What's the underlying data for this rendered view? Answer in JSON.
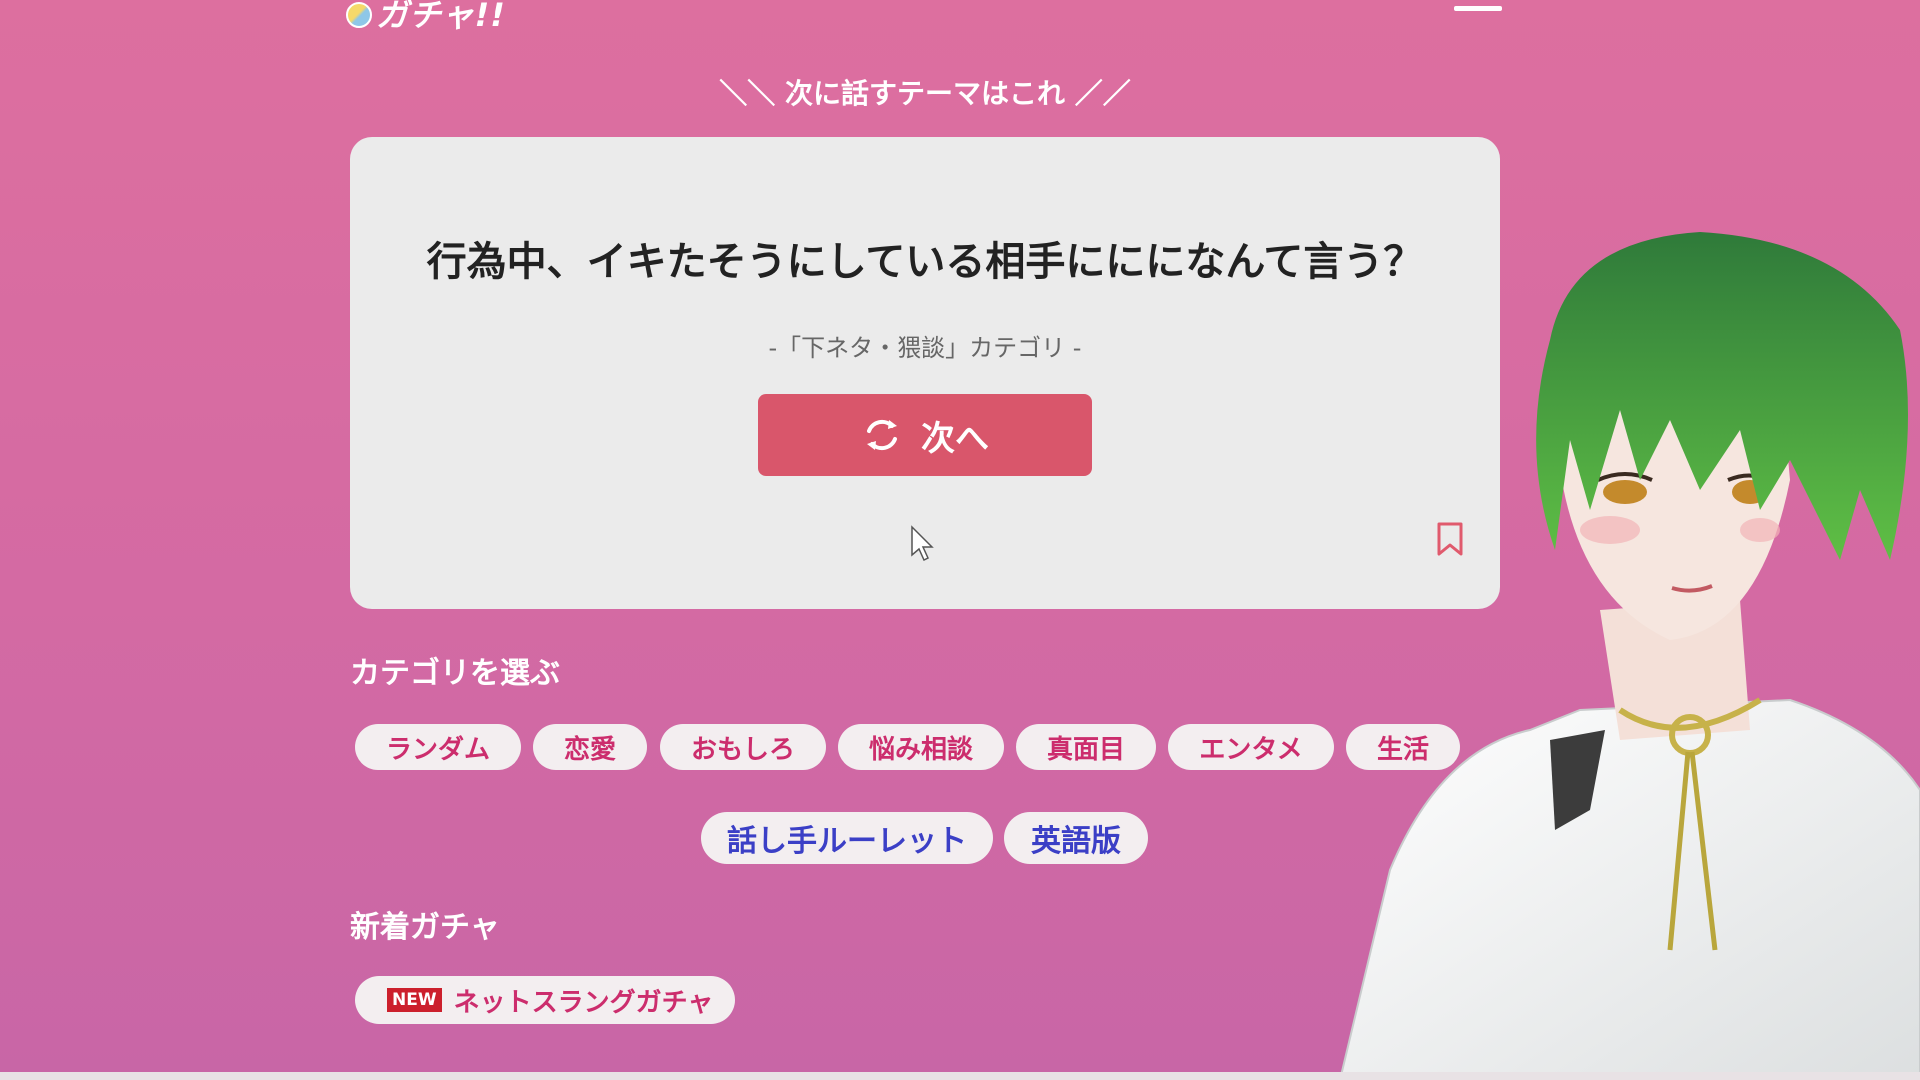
{
  "header": {
    "logo_text": "ガチャ!!",
    "menu_icon": "hamburger-icon"
  },
  "headline": "＼＼ 次に話すテーマはこれ ／／",
  "card": {
    "question": "行為中、イキたそうにしている相手ににになんて言う？",
    "category": "-「下ネタ・猥談」カテゴリ -",
    "next_button_label": "次へ",
    "next_button_icon": "refresh-icon",
    "bookmark_icon": "bookmark-icon"
  },
  "categories": {
    "title": "カテゴリを選ぶ",
    "items": [
      "ランダム",
      "恋愛",
      "おもしろ",
      "悩み相談",
      "真面目",
      "エンタメ",
      "生活"
    ],
    "extra": [
      "話し手ルーレット",
      "英語版"
    ]
  },
  "new_gacha": {
    "title": "新着ガチャ",
    "badge": "NEW",
    "item": "ネットスラングガチャ"
  },
  "colors": {
    "accent": "#d9566b",
    "chip_text": "#cc2d6d",
    "chip_text_blue": "#3b3fc6",
    "background": "#dd6f9f"
  }
}
